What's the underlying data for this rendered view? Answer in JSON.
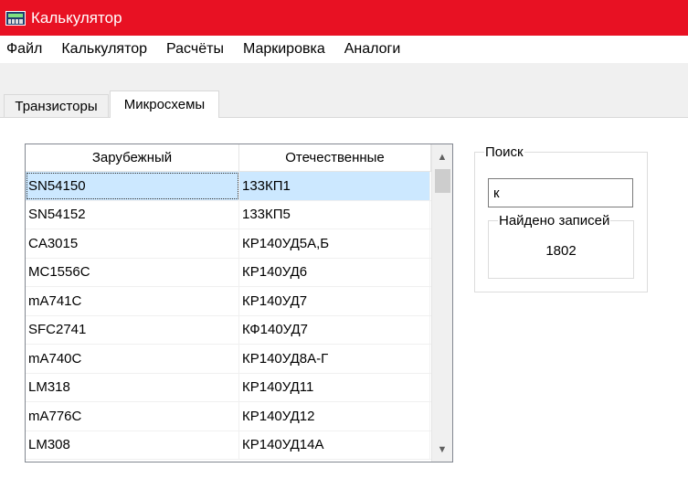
{
  "window": {
    "title": "Калькулятор",
    "icon": "calculator-icon"
  },
  "menu": [
    "Файл",
    "Калькулятор",
    "Расчёты",
    "Маркировка",
    "Аналоги"
  ],
  "tabs": {
    "inactive": "Транзисторы",
    "active": "Микросхемы"
  },
  "grid": {
    "columns": [
      "Зарубежный",
      "Отечественные"
    ],
    "rows": [
      [
        "SN54150",
        "133КП1"
      ],
      [
        "SN54152",
        "133КП5"
      ],
      [
        "CA3015",
        "КР140УД5А,Б"
      ],
      [
        "MC1556C",
        "КР140УД6"
      ],
      [
        "mA741C",
        "КР140УД7"
      ],
      [
        "SFC2741",
        "КФ140УД7"
      ],
      [
        "mA740C",
        "КР140УД8А-Г"
      ],
      [
        "LM318",
        "КР140УД11"
      ],
      [
        "mA776C",
        "КР140УД12"
      ],
      [
        "LM308",
        "КР140УД14А"
      ]
    ],
    "selected_row": 0
  },
  "search": {
    "group_label": "Поиск",
    "value": "к",
    "found_label": "Найдено записей",
    "found_count": "1802"
  }
}
